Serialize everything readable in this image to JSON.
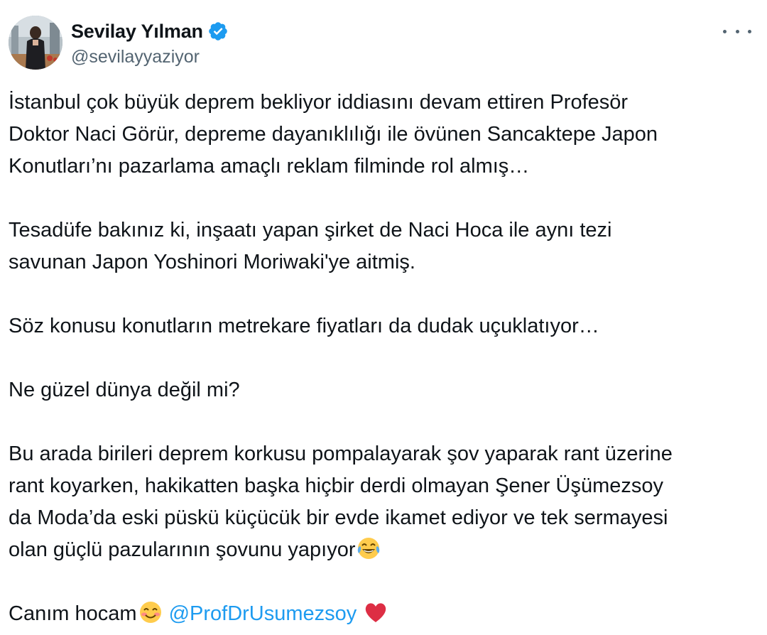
{
  "tweet": {
    "author": {
      "display_name": "Sevilay Yılman",
      "handle": "@sevilayyaziyor",
      "verified": true
    },
    "menu_icon": "more-dots-icon",
    "paragraphs": [
      {
        "lines": [
          "İstanbul çok büyük deprem bekliyor iddiasını devam ettiren Profesör",
          "Doktor Naci Görür, depreme dayanıklılığı ile övünen Sancaktepe Japon",
          "Konutları’nı pazarlama amaçlı reklam filminde rol almış…"
        ]
      },
      {
        "lines": [
          "Tesadüfe bakınız ki, inşaatı yapan şirket de Naci Hoca ile aynı tezi",
          "savunan Japon Yoshinori Moriwaki'ye aitmiş."
        ]
      },
      {
        "lines": [
          "Söz konusu konutların metrekare fiyatları da dudak uçuklatıyor…"
        ]
      },
      {
        "lines": [
          "Ne güzel dünya değil mi?"
        ]
      },
      {
        "lines": [
          "Bu arada birileri deprem korkusu pompalayarak şov yaparak rant üzerine",
          "rant koyarken, hakikatten başka hiçbir derdi olmayan Şener Üşümezsoy",
          "da Moda’da eski püskü küçücük bir evde ikamet ediyor ve tek sermayesi"
        ]
      }
    ],
    "last_line_p5": "olan güçlü pazularının şovunu yapıyor",
    "closing": {
      "text": "Canım hocam",
      "mention": "@ProfDrUsumezsoy"
    },
    "colors": {
      "text": "#0f1419",
      "secondary": "#536471",
      "link": "#1d9bf0",
      "verified": "#1d9bf0",
      "heart": "#e0245e"
    },
    "emojis": [
      "tears-of-joy-emoji",
      "smiling-blush-emoji",
      "red-heart-emoji"
    ]
  }
}
